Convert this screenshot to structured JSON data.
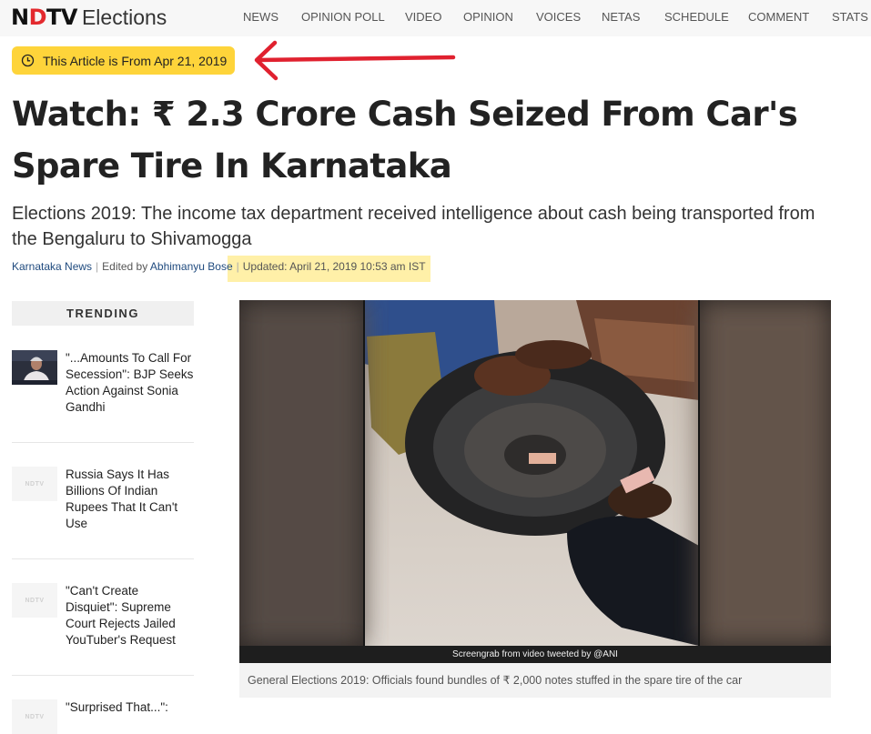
{
  "header": {
    "logo_brand": "NDTV",
    "logo_section": "Elections",
    "nav": [
      "NEWS",
      "OPINION POLL",
      "VIDEO",
      "OPINION",
      "VOICES",
      "NETAS",
      "SCHEDULE",
      "COMMENT",
      "STATS"
    ]
  },
  "date_notice": {
    "icon": "clock-icon",
    "text": "This Article is From Apr 21, 2019"
  },
  "article": {
    "headline": "Watch: ₹ 2.3 Crore Cash Seized From Car's Spare Tire In Karnataka",
    "subhead": "Elections 2019: The income tax department received intelligence about cash being transported from the Bengaluru to Shivamogga",
    "byline": {
      "category": "Karnataka News",
      "edited_prefix": "Edited by",
      "editor": "Abhimanyu Bose",
      "updated": "Updated: April 21, 2019 10:53 am IST"
    },
    "media": {
      "credit": "Screengrab from video tweeted by @ANI",
      "caption": "General Elections 2019: Officials found bundles of ₹ 2,000 notes stuffed in the spare tire of the car"
    }
  },
  "trending": {
    "heading": "TRENDING",
    "placeholder_logo": "NDTV",
    "items": [
      {
        "title": "\"...Amounts To Call For Secession\": BJP Seeks Action Against Sonia Gandhi"
      },
      {
        "title": "Russia Says It Has Billions Of Indian Rupees That It Can't Use"
      },
      {
        "title": "\"Can't Create Disquiet\": Supreme Court Rejects Jailed YouTuber's Request"
      },
      {
        "title": "\"Surprised That...\":"
      }
    ]
  },
  "colors": {
    "date_pill": "#fed43a",
    "arrow": "#e0212f",
    "update_highlight": "#fff0a8",
    "brand_red": "#e3292e",
    "link_blue": "#1f4a7e"
  }
}
